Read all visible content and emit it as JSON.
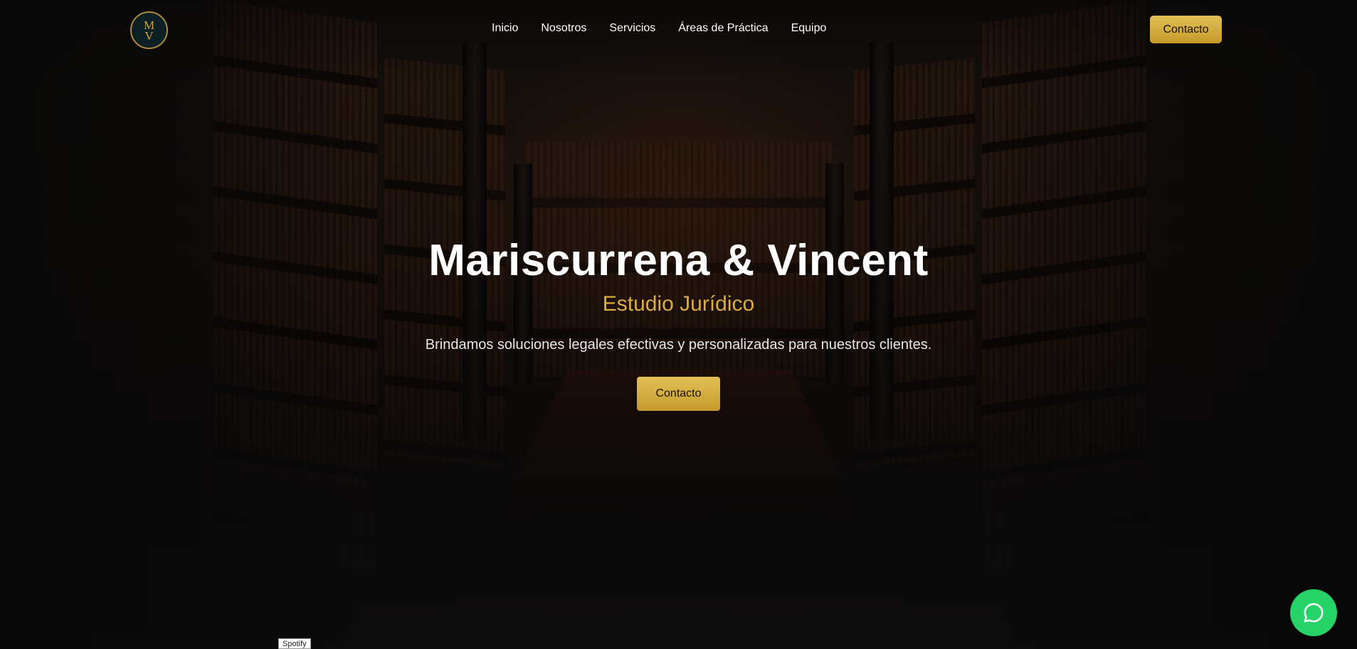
{
  "navbar": {
    "logo_letters": [
      "M",
      "V"
    ],
    "links": [
      "Inicio",
      "Nosotros",
      "Servicios",
      "Áreas de Práctica",
      "Equipo"
    ],
    "cta_label": "Contacto"
  },
  "hero": {
    "title": "Mariscurrena & Vincent",
    "subtitle": "Estudio Jurídico",
    "description": "Brindamos soluciones legales efectivas y personalizadas para nuestros clientes.",
    "cta_label": "Contacto"
  },
  "floating": {
    "whatsapp_icon": "whatsapp-icon",
    "spotify_label": "Spotify"
  },
  "colors": {
    "accent_gold": "#d9ad3f",
    "button_gold": "#d4ad3f",
    "whatsapp_green": "#25d366",
    "background": "#0c0b0b"
  }
}
